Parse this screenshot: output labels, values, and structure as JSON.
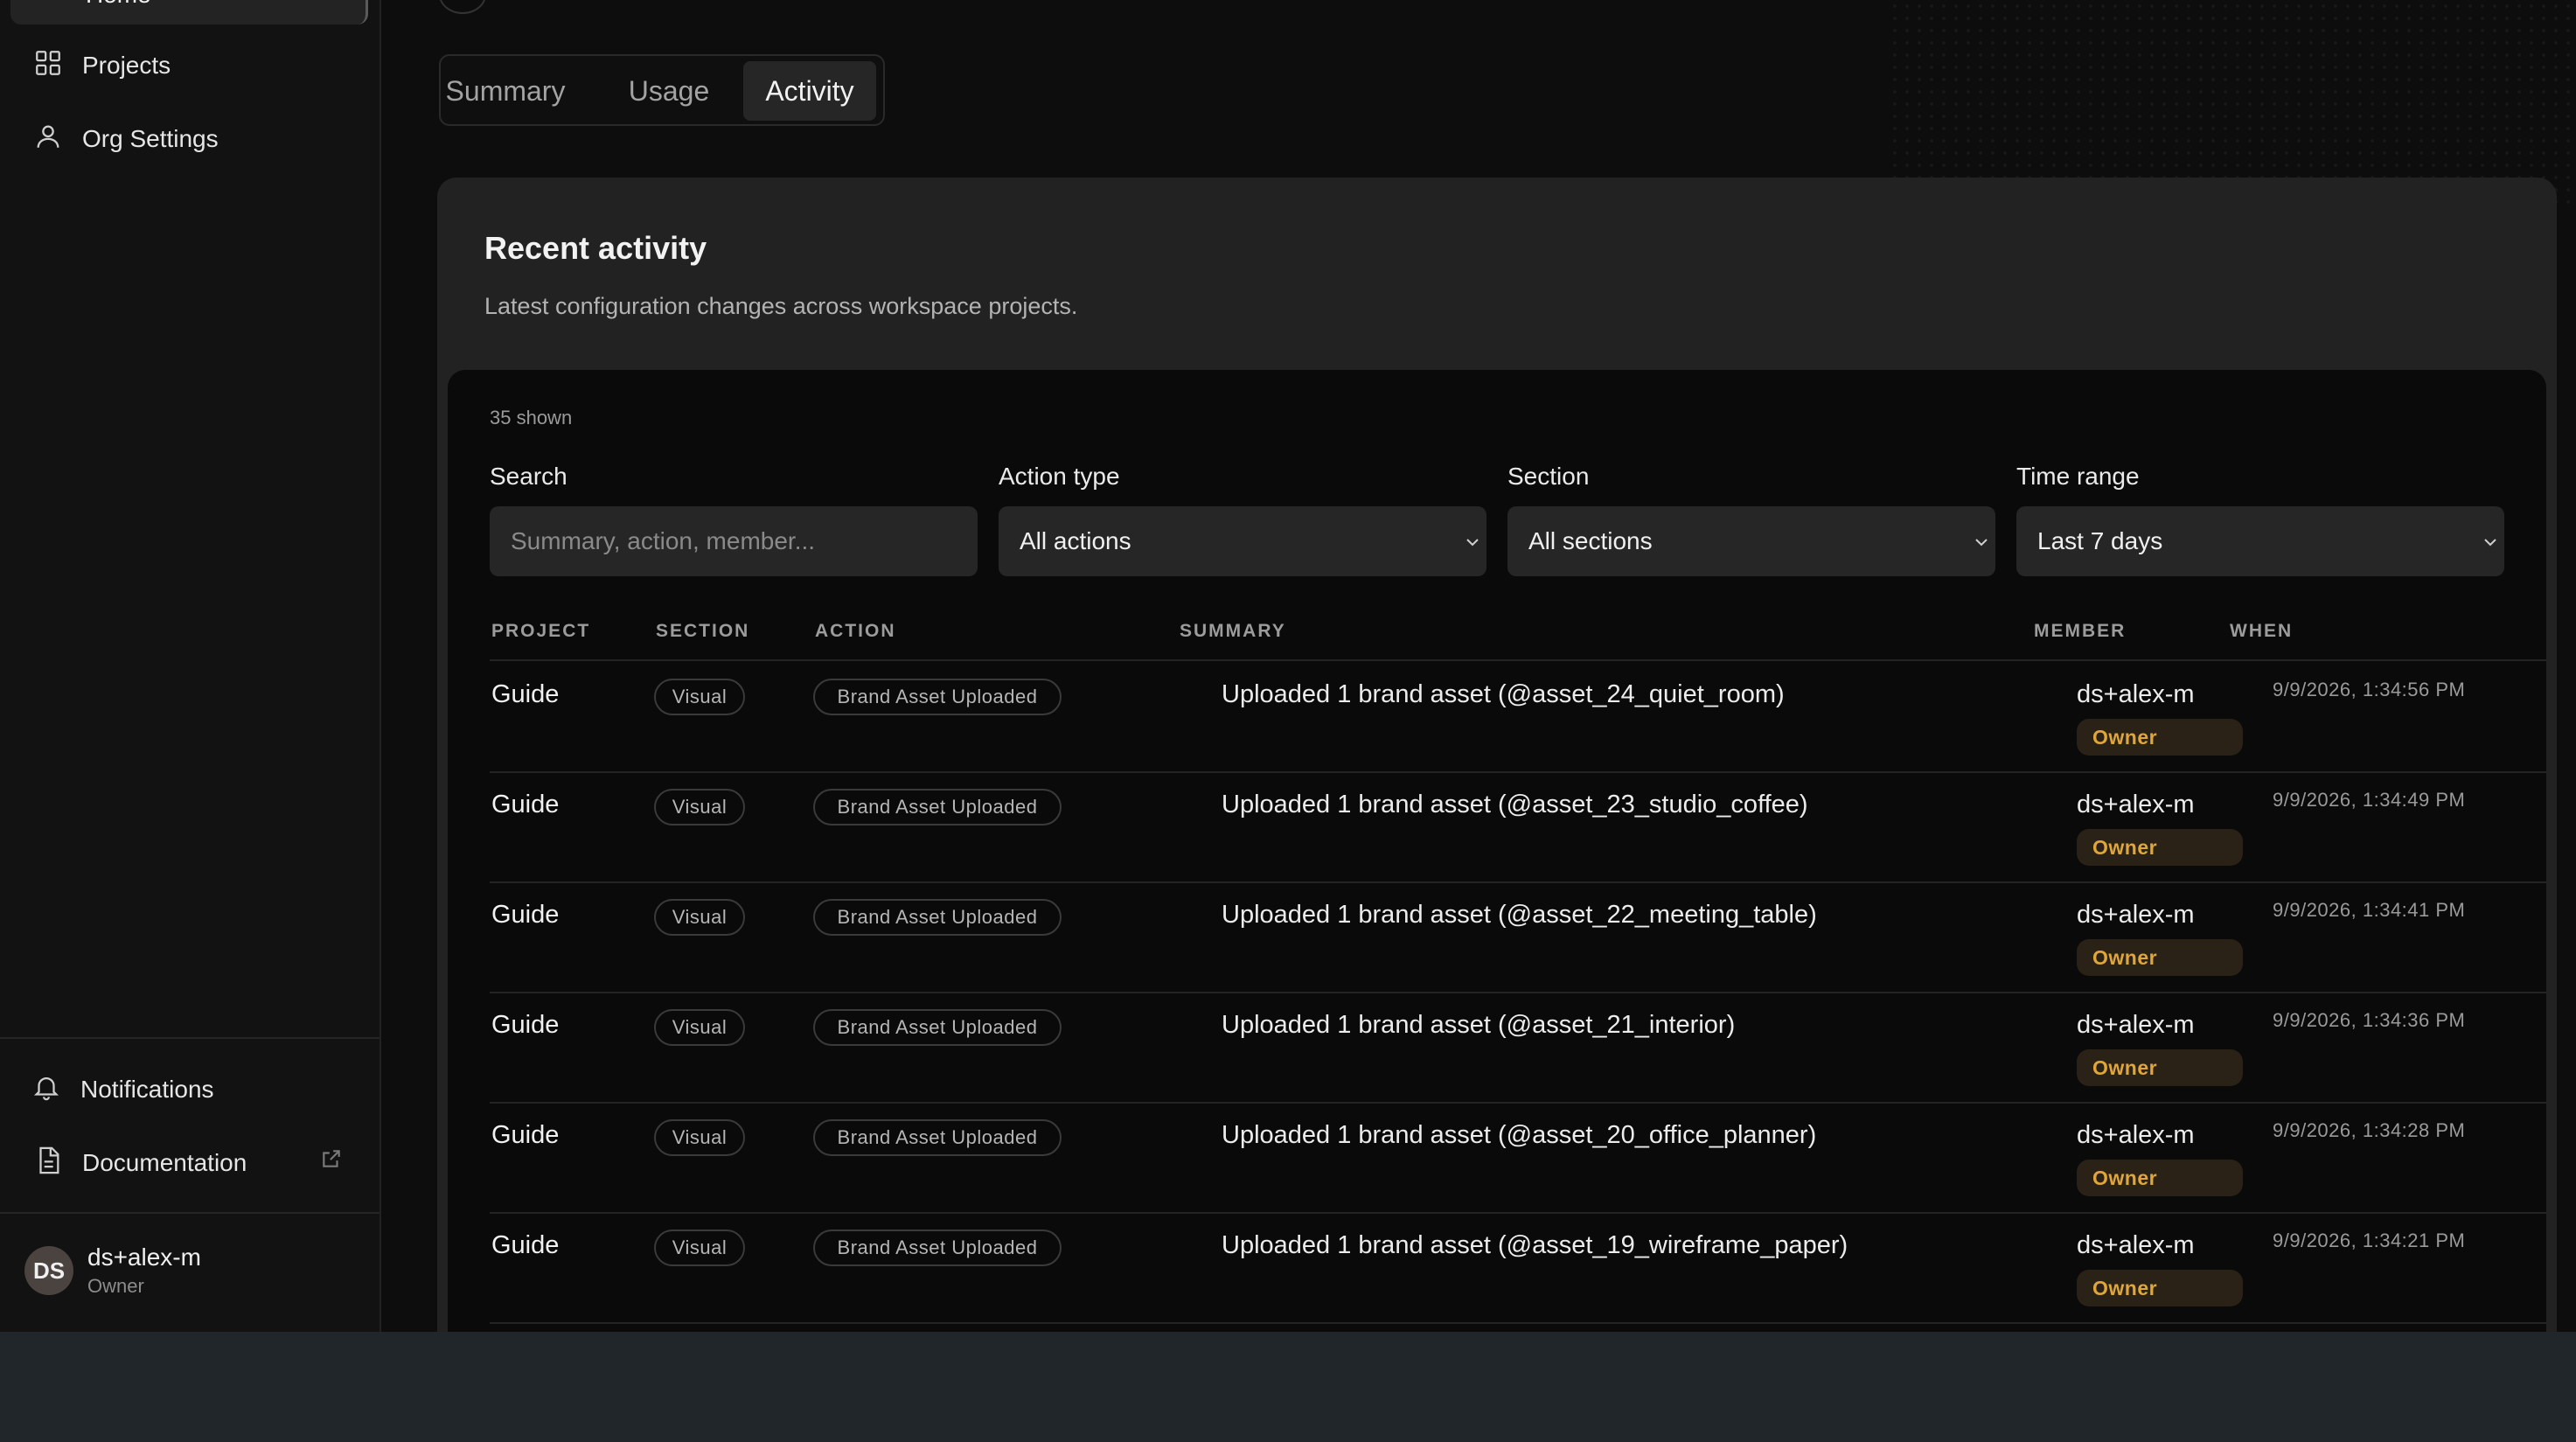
{
  "sidebar": {
    "home_label": "Home",
    "nav": [
      {
        "label": "Projects",
        "icon": "grid-icon"
      },
      {
        "label": "Org Settings",
        "icon": "user-icon"
      }
    ],
    "footer_nav": [
      {
        "label": "Notifications",
        "icon": "bell-icon"
      },
      {
        "label": "Documentation",
        "icon": "document-icon"
      }
    ],
    "user": {
      "initials": "DS",
      "name": "ds+alex-m",
      "role": "Owner"
    }
  },
  "tabs": [
    "Summary",
    "Usage",
    "Activity"
  ],
  "active_tab": "Activity",
  "card": {
    "title": "Recent activity",
    "subtitle": "Latest configuration changes across workspace projects."
  },
  "panel": {
    "count": "35 shown",
    "filters": {
      "search_label": "Search",
      "search_placeholder": "Summary, action, member...",
      "action_label": "Action type",
      "action_value": "All actions",
      "section_label": "Section",
      "section_value": "All sections",
      "time_label": "Time range",
      "time_value": "Last 7 days"
    },
    "columns": [
      "PROJECT",
      "SECTION",
      "ACTION",
      "SUMMARY",
      "MEMBER",
      "WHEN"
    ],
    "rows": [
      {
        "project": "Guide",
        "section": "Visual",
        "action": "Brand Asset Uploaded",
        "summary": "Uploaded 1 brand asset (@asset_24_quiet_room)",
        "member": "ds+alex-m",
        "role": "Owner",
        "when": "9/9/2026, 1:34:56 PM"
      },
      {
        "project": "Guide",
        "section": "Visual",
        "action": "Brand Asset Uploaded",
        "summary": "Uploaded 1 brand asset (@asset_23_studio_coffee)",
        "member": "ds+alex-m",
        "role": "Owner",
        "when": "9/9/2026, 1:34:49 PM"
      },
      {
        "project": "Guide",
        "section": "Visual",
        "action": "Brand Asset Uploaded",
        "summary": "Uploaded 1 brand asset (@asset_22_meeting_table)",
        "member": "ds+alex-m",
        "role": "Owner",
        "when": "9/9/2026, 1:34:41 PM"
      },
      {
        "project": "Guide",
        "section": "Visual",
        "action": "Brand Asset Uploaded",
        "summary": "Uploaded 1 brand asset (@asset_21_interior)",
        "member": "ds+alex-m",
        "role": "Owner",
        "when": "9/9/2026, 1:34:36 PM"
      },
      {
        "project": "Guide",
        "section": "Visual",
        "action": "Brand Asset Uploaded",
        "summary": "Uploaded 1 brand asset (@asset_20_office_planner)",
        "member": "ds+alex-m",
        "role": "Owner",
        "when": "9/9/2026, 1:34:28 PM"
      },
      {
        "project": "Guide",
        "section": "Visual",
        "action": "Brand Asset Uploaded",
        "summary": "Uploaded 1 brand asset (@asset_19_wireframe_paper)",
        "member": "ds+alex-m",
        "role": "Owner",
        "when": "9/9/2026, 1:34:21 PM"
      }
    ]
  },
  "colors": {
    "accent_owner": "#e0a63a",
    "panel_bg": "#0a0a0a",
    "card_bg": "#222222"
  }
}
